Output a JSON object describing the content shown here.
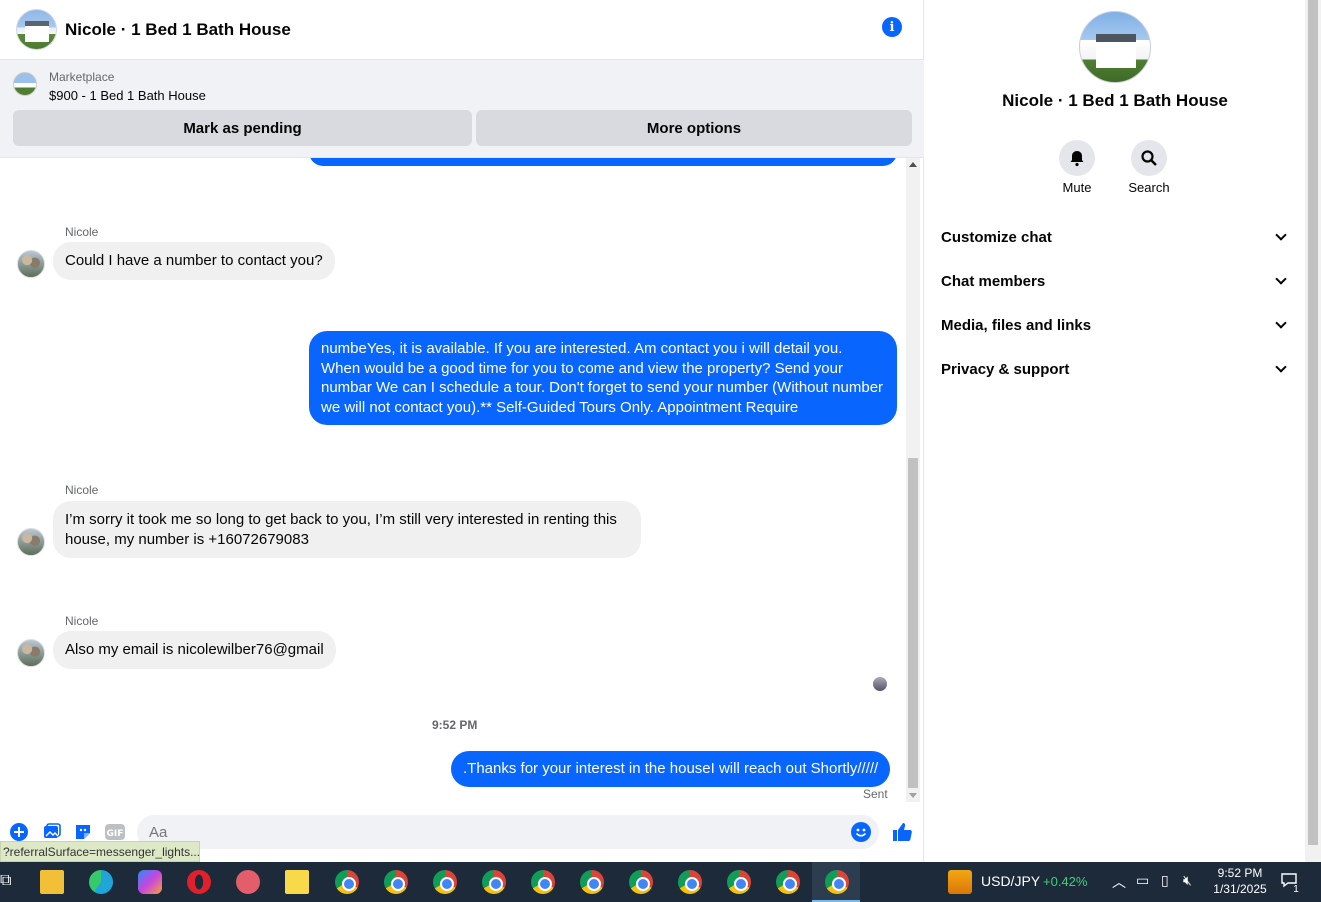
{
  "header": {
    "title": "Nicole · 1 Bed 1 Bath House"
  },
  "marketplace": {
    "label": "Marketplace",
    "listing": "$900 - 1 Bed 1 Bath House",
    "mark_pending": "Mark as pending",
    "more_options": "More options"
  },
  "messages": {
    "sender": "Nicole",
    "m1": "Could I have a number to contact you?",
    "m2": "numbeYes, it is available. If you are interested.  Am contact you i will detail you. When would be a good time for you to come and view the property? Send your numbar We can I schedule a tour.  Don't forget to send your number (Without number we will not contact you).** Self-Guided Tours Only. Appointment Require",
    "m3": "I’m sorry it took me so long to get back to you, I’m still very interested in renting this house, my number is +16072679083",
    "m4": "Also my email is nicolewilber76@gmail",
    "time": "9:52 PM",
    "m5": ".Thanks for your interest in the houseI will reach out Shortly/////",
    "status": "Sent"
  },
  "composer": {
    "placeholder": "Aa"
  },
  "status_tip": "?referralSurface=messenger_lights...",
  "panel": {
    "name": "Nicole · 1 Bed 1 Bath House",
    "mute": "Mute",
    "search": "Search",
    "sections": [
      "Customize chat",
      "Chat members",
      "Media, files and links",
      "Privacy & support"
    ]
  },
  "taskbar": {
    "ticker": "USD/JPY",
    "change": "+0.42%",
    "time": "9:52 PM",
    "date": "1/31/2025",
    "notif_count": "1"
  },
  "colors": {
    "accent": "#0866ff",
    "bubble_in": "#f0f0f0",
    "taskbar": "#1c2a3a",
    "ticker_up": "#3fd07c"
  }
}
